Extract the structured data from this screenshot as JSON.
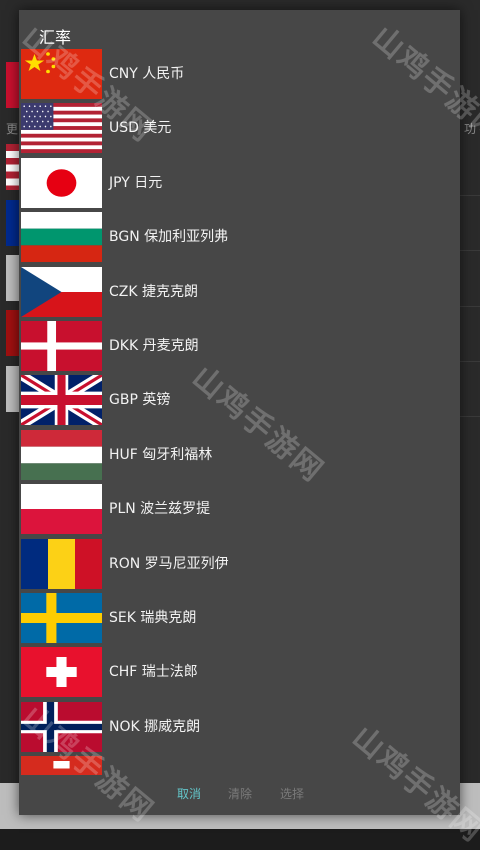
{
  "background": {
    "left_text": "更",
    "right_text": "功"
  },
  "dialog": {
    "title": "汇率",
    "items": [
      {
        "code": "CNY",
        "name": "人民币",
        "label": "CNY  人民币",
        "flag": "cn-flag-icon"
      },
      {
        "code": "USD",
        "name": "美元",
        "label": "USD  美元",
        "flag": "us-flag-icon"
      },
      {
        "code": "JPY",
        "name": "日元",
        "label": "JPY  日元",
        "flag": "jp-flag-icon"
      },
      {
        "code": "BGN",
        "name": "保加利亚列弗",
        "label": "BGN  保加利亚列弗",
        "flag": "bg-flag-icon"
      },
      {
        "code": "CZK",
        "name": "捷克克朗",
        "label": "CZK  捷克克朗",
        "flag": "cz-flag-icon"
      },
      {
        "code": "DKK",
        "name": "丹麦克朗",
        "label": "DKK  丹麦克朗",
        "flag": "dk-flag-icon"
      },
      {
        "code": "GBP",
        "name": "英镑",
        "label": "GBP  英镑",
        "flag": "gb-flag-icon"
      },
      {
        "code": "HUF",
        "name": "匈牙利福林",
        "label": "HUF  匈牙利福林",
        "flag": "hu-flag-icon"
      },
      {
        "code": "PLN",
        "name": "波兰兹罗提",
        "label": "PLN  波兰兹罗提",
        "flag": "pl-flag-icon"
      },
      {
        "code": "RON",
        "name": "罗马尼亚列伊",
        "label": "RON  罗马尼亚列伊",
        "flag": "ro-flag-icon"
      },
      {
        "code": "SEK",
        "name": "瑞典克朗",
        "label": "SEK  瑞典克朗",
        "flag": "se-flag-icon"
      },
      {
        "code": "CHF",
        "name": "瑞士法郎",
        "label": "CHF  瑞士法郎",
        "flag": "ch-flag-icon"
      },
      {
        "code": "NOK",
        "name": "挪威克朗",
        "label": "NOK  挪威克朗",
        "flag": "no-flag-icon"
      }
    ],
    "buttons": {
      "cancel": "取消",
      "clear": "清除",
      "select": "选择"
    }
  },
  "watermark": "山鸡手游网",
  "colors": {
    "dialog_bg": "#474747",
    "accent": "#63c5c9",
    "disabled": "#7a7a7a"
  }
}
